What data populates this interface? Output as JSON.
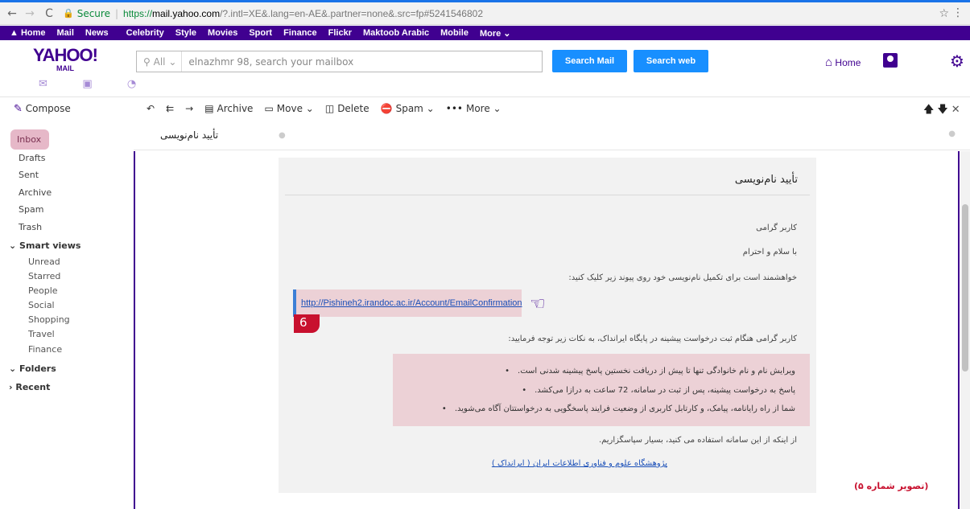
{
  "browser": {
    "back_icon": "←",
    "forward_icon": "→",
    "reload_icon": "C",
    "secure_label": "Secure",
    "url_scheme": "https://",
    "url_host": "mail.yahoo.com",
    "url_rest": "/?.intl=XE&.lang=en-AE&.partner=none&.src=fp#5241546802"
  },
  "yahoo_nav": {
    "items": [
      "Home",
      "Mail",
      "News",
      "Celebrity",
      "Style",
      "Movies",
      "Sport",
      "Finance",
      "Flickr",
      "Maktoob Arabic",
      "Mobile",
      "More ⌄"
    ]
  },
  "header": {
    "logo_text": "YAHOO!",
    "logo_sub": "MAIL",
    "search_scope": "All",
    "search_placeholder": "elnazhmr 98, search your mailbox",
    "search_mail_label": "Search Mail",
    "search_web_label": "Search web",
    "home_label": "Home"
  },
  "toolbar": {
    "compose_label": "Compose",
    "archive_label": "Archive",
    "move_label": "Move ⌄",
    "delete_label": "Delete",
    "spam_label": "Spam ⌄",
    "more_label": "More ⌄"
  },
  "sidebar": {
    "inbox": "Inbox",
    "drafts": "Drafts",
    "sent": "Sent",
    "archive": "Archive",
    "spam": "Spam",
    "trash": "Trash",
    "smart_views": "Smart views",
    "smart_items": [
      "Unread",
      "Starred",
      "People",
      "Social",
      "Shopping",
      "Travel",
      "Finance"
    ],
    "folders": "Folders",
    "recent": "Recent"
  },
  "message": {
    "subject": "تأیید نام‌نویسی",
    "title": "تأیید نام‌نویسی",
    "greeting": "کاربر گرامی",
    "salutation": "با سلام و احترام",
    "instruction": "خواهشمند است برای تکمیل نام‌نویسی خود روی پیوند زیر کلیک کنید:",
    "link": "http://Pishineh2.irandoc.ac.ir/Account/EmailConfirmation",
    "badge_number": "6",
    "notice_intro": "کاربر گرامی هنگام ثبت درخواست پیشینه در پایگاه ایرانداک، به نکات زیر توجه فرمایید:",
    "notes": [
      "ویرایش نام و نام خانوادگی تنها تا پیش از دریافت نخستین پاسخ پیشینه شدنی است.",
      "پاسخ به درخواست پیشینه، پس از ثبت در سامانه، 72 ساعت به درازا می‌کشد.",
      "شما از راه رایانامه، پیامک، و کارتابل کاربری از وضعیت فرایند پاسخگویی به درخواستتان آگاه می‌شوید."
    ],
    "thanks": "از اینکه از این سامانه استفاده می کنید، بسیار سپاسگزاریم.",
    "footer_link": "پژوهشگاه علوم و فناوری اطلاعات ایران ( ایرانداک )"
  },
  "caption": "(تصویر شماره ۵)",
  "colors": {
    "brand_purple": "#400090",
    "search_blue": "#188fff",
    "inbox_highlight": "#e6b8c8",
    "note_background": "#ecd1d6",
    "caption_red": "#c8102e"
  }
}
